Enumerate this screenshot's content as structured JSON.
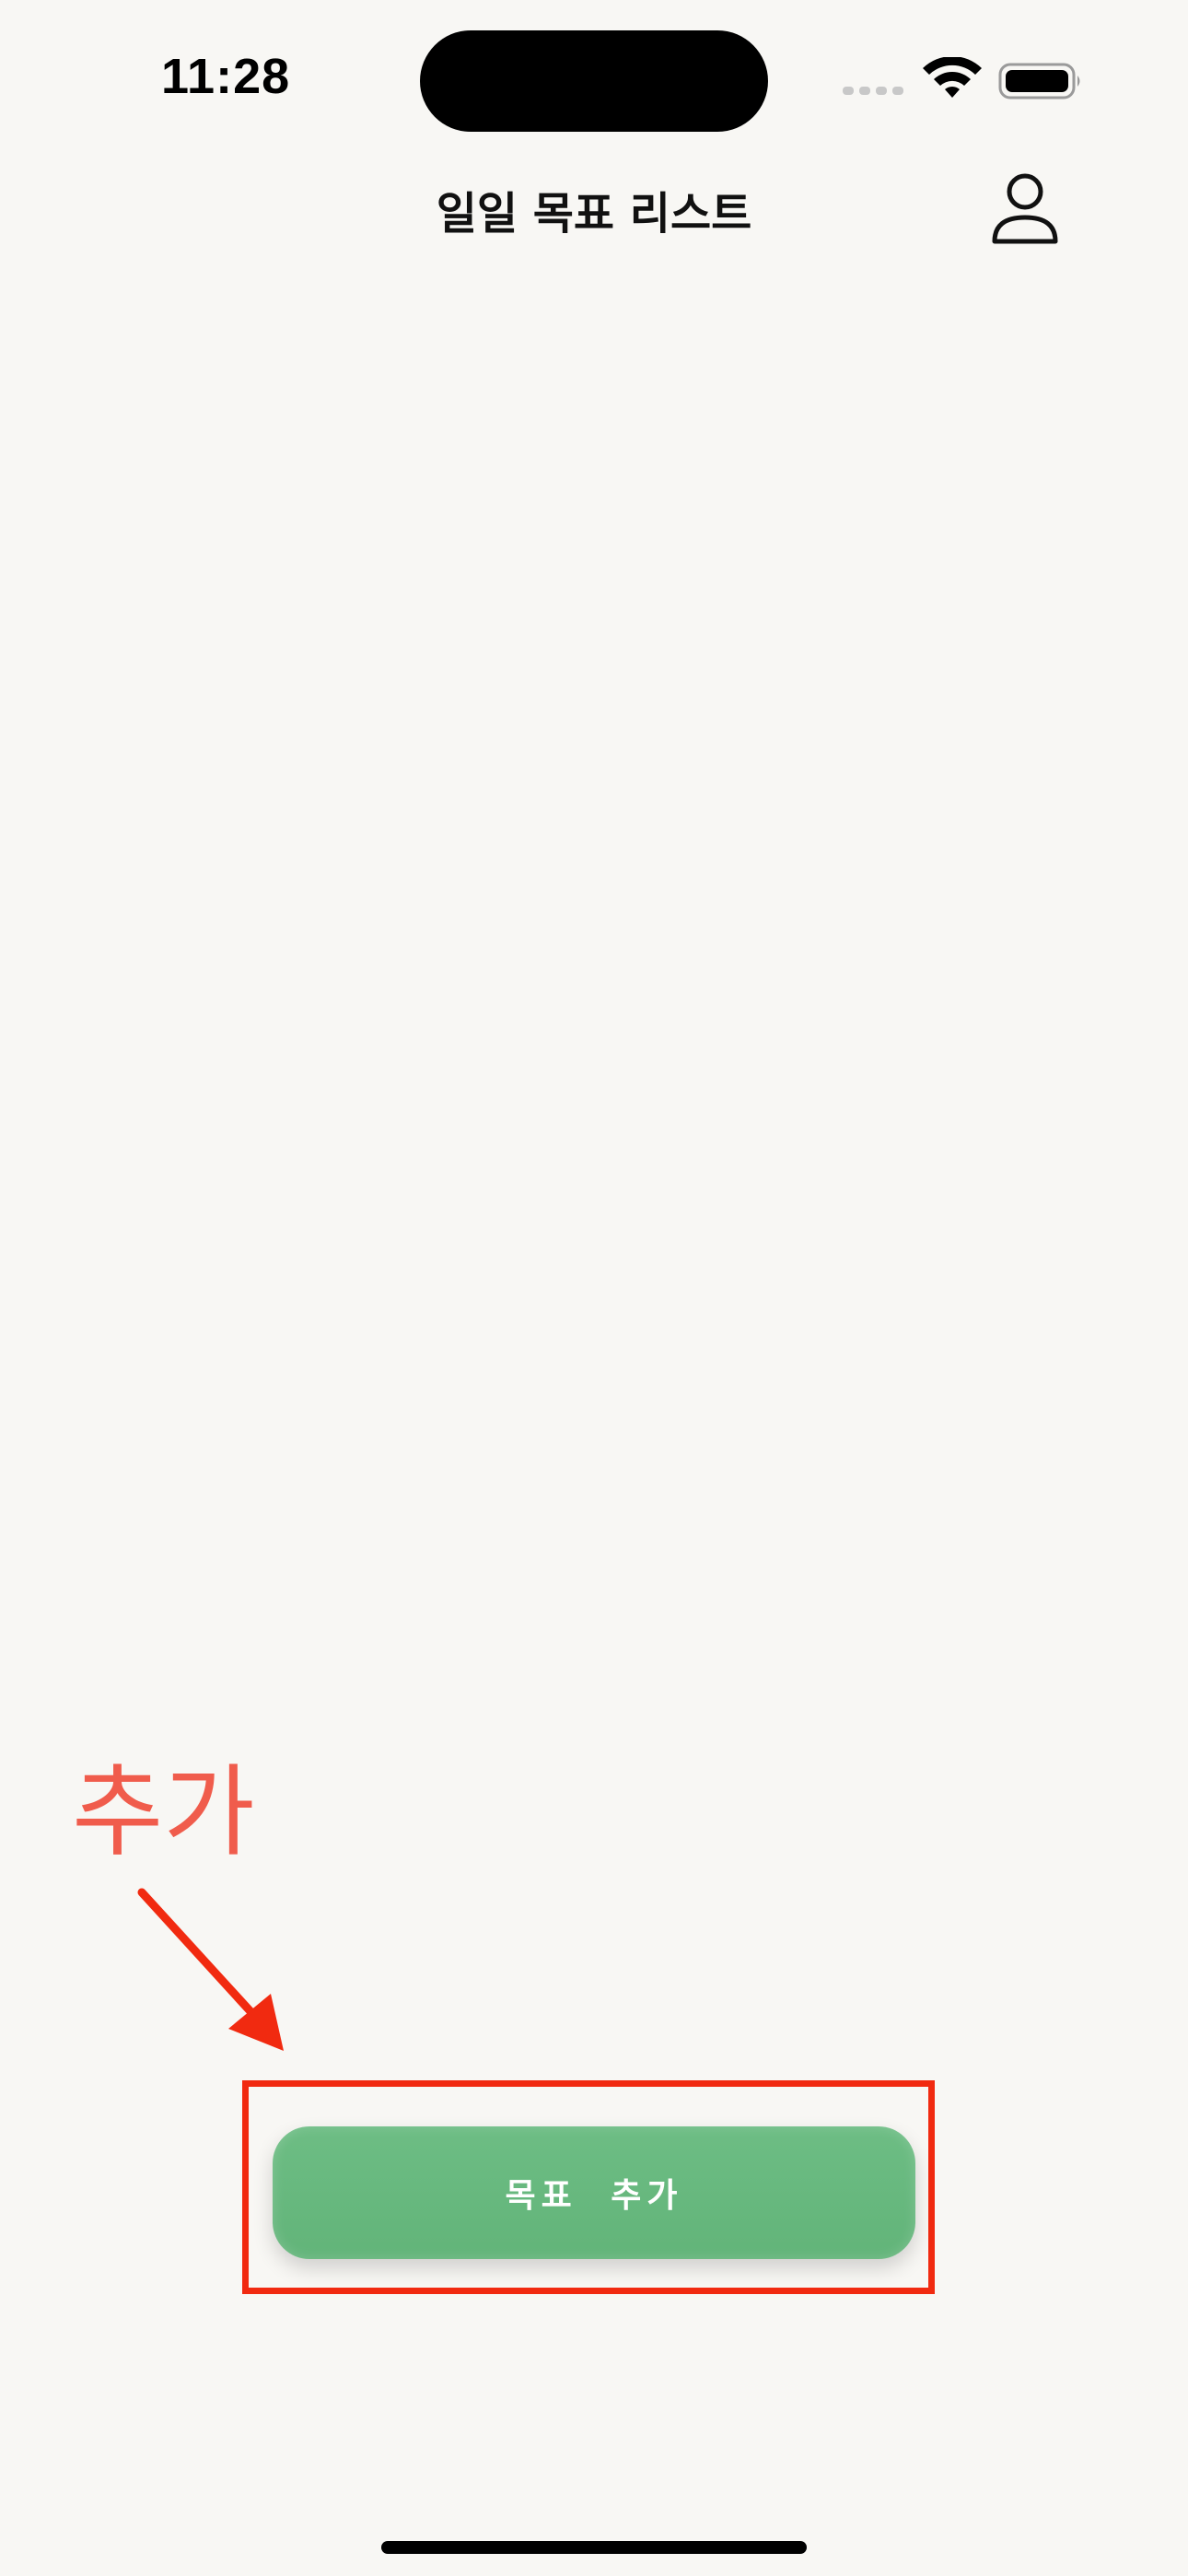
{
  "status_bar": {
    "time": "11:28",
    "icons": [
      "cellular-icon",
      "wifi-icon",
      "battery-icon"
    ]
  },
  "nav": {
    "title": "일일 목표 리스트",
    "profile_icon": "person-icon"
  },
  "annotation": {
    "label": "추가",
    "color": "#f05c4c",
    "box_color": "#f12a10"
  },
  "main": {
    "add_button_label": "목표 추가",
    "button_color": "#66b77d"
  }
}
